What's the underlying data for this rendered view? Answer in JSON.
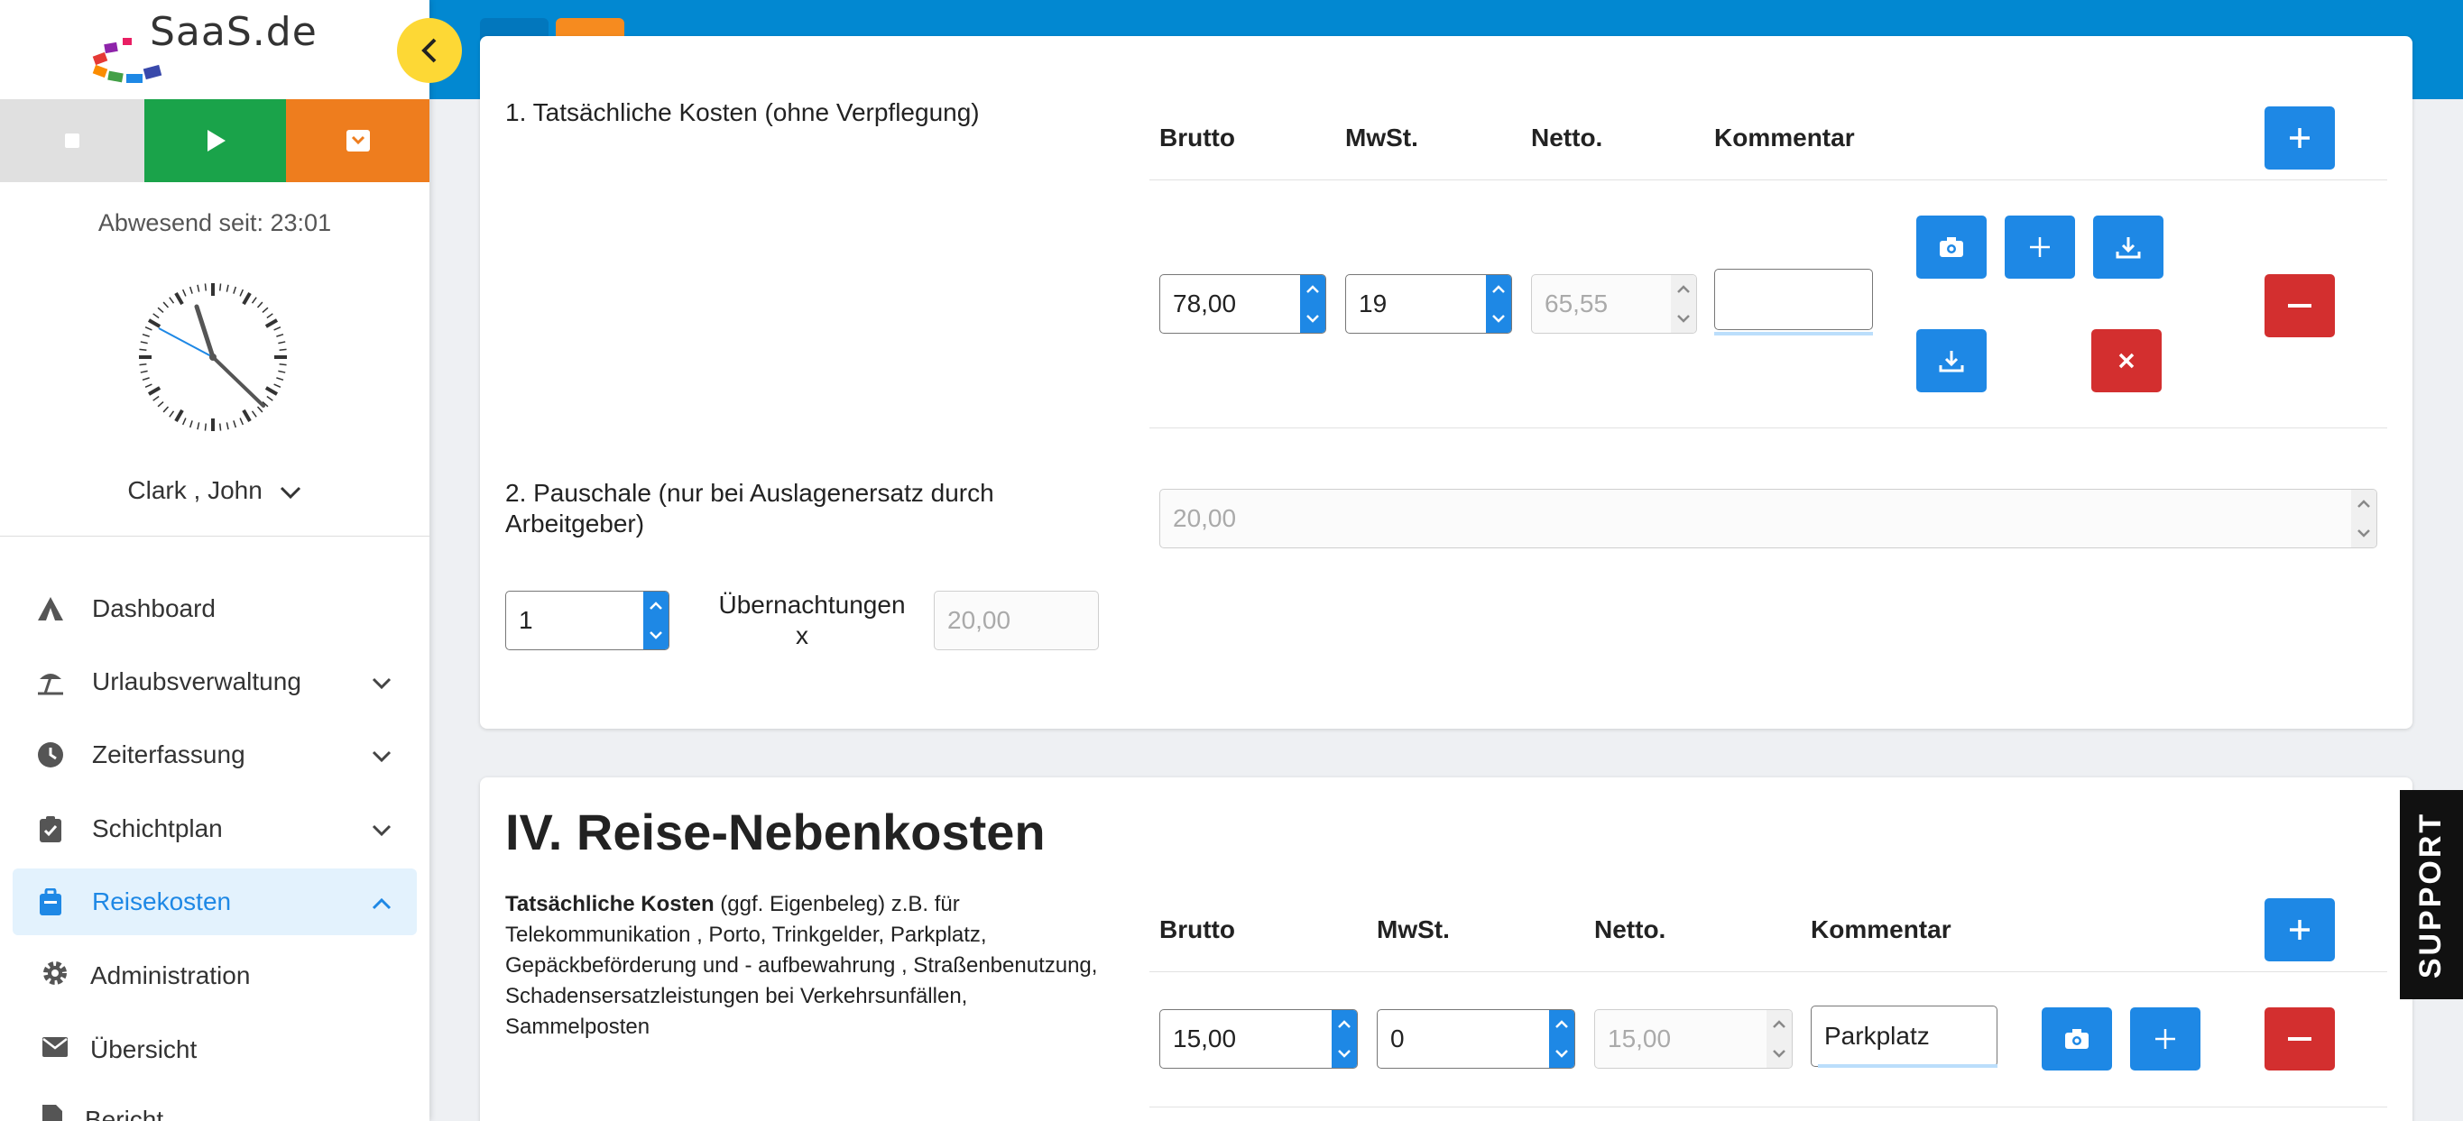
{
  "app": {
    "logo_text": "SaaS.de"
  },
  "sidebar": {
    "absent_text": "Abwesend seit: 23:01",
    "user_name": "Clark , John",
    "nav": [
      {
        "label": "Dashboard",
        "icon": "dashboard-icon"
      },
      {
        "label": "Urlaubsverwaltung",
        "icon": "beach-icon"
      },
      {
        "label": "Zeiterfassung",
        "icon": "clock-icon"
      },
      {
        "label": "Schichtplan",
        "icon": "clipboard-icon"
      },
      {
        "label": "Reisekosten",
        "icon": "briefcase-icon"
      }
    ],
    "sub": [
      {
        "label": "Administration",
        "icon": "gear-icon"
      },
      {
        "label": "Übersicht",
        "icon": "envelope-icon"
      },
      {
        "label": "Bericht",
        "icon": "file-icon"
      }
    ]
  },
  "card1": {
    "row1_label": "1. Tatsächliche Kosten (ohne Verpflegung)",
    "headers": {
      "brutto": "Brutto",
      "mwst": "MwSt.",
      "netto": "Netto.",
      "kommentar": "Kommentar"
    },
    "brutto": "78,00",
    "mwst": "19",
    "netto": "65,55",
    "kommentar": "",
    "row2_label_1": "2. Pauschale (nur bei Auslagenersatz durch",
    "row2_label_2": "Arbeitgeber)",
    "pauschale": "20,00",
    "nights": "1",
    "nights_label_1": "Übernachtungen",
    "nights_label_2": "x",
    "nights_rate": "20,00"
  },
  "card2": {
    "title": "IV. Reise-Nebenkosten",
    "desc_bold": "Tatsächliche Kosten",
    "desc_line1": " (ggf. Eigenbeleg) z.B. für",
    "desc_line2": "Telekommunikation , Porto, Trinkgelder, Parkplatz,",
    "desc_line3": "Gepäckbeförderung und - aufbewahrung , Straßenbenutzung,",
    "desc_line4": "Schadensersatzleistungen bei Verkehrsunfällen,",
    "desc_line5": "Sammelposten",
    "headers": {
      "brutto": "Brutto",
      "mwst": "MwSt.",
      "netto": "Netto.",
      "kommentar": "Kommentar"
    },
    "brutto": "15,00",
    "mwst": "0",
    "netto": "15,00",
    "kommentar": "Parkplatz"
  },
  "support_label": "SUPPORT",
  "colors": {
    "topbar": "#0288d1",
    "accent": "#1e88e5",
    "danger": "#d32f2f",
    "success": "#1aa34a",
    "warning": "#ee7d1e"
  }
}
